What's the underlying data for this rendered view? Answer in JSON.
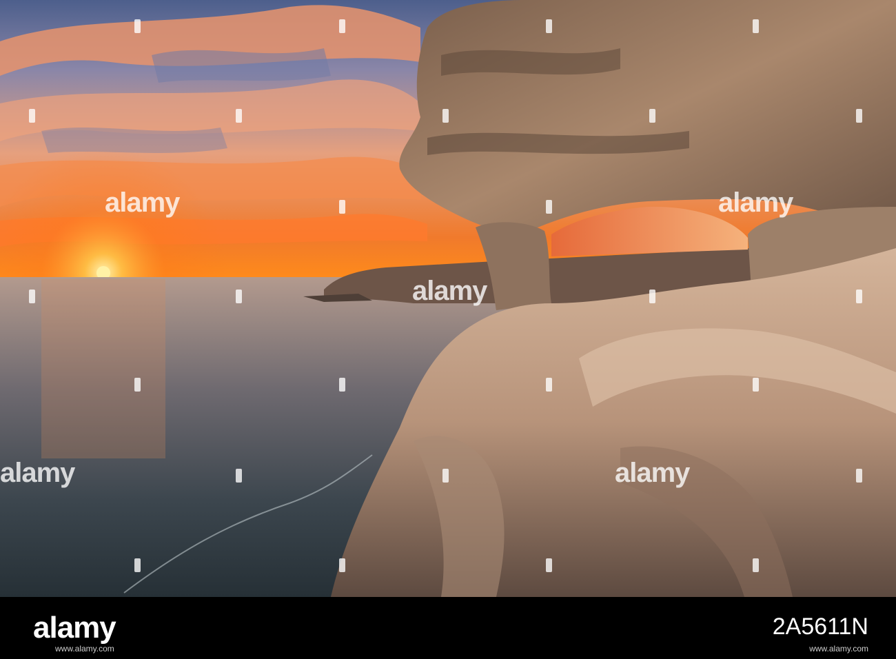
{
  "photo": {
    "subject": "",
    "colors": {
      "sky_top": "#5b6e98",
      "sky_mid": "#e88a5a",
      "horizon": "#f26a1b",
      "sun": "#ffd34a",
      "sea_top": "#9a8d88",
      "sea_bottom": "#2f3a40",
      "rock_light": "#c9ad95",
      "rock_dark": "#3a2c24"
    }
  },
  "watermarks": {
    "tile_text": "alamy"
  },
  "footer": {
    "logo": "alamy",
    "image_id": "2A5611N",
    "url": "www.alamy.com"
  }
}
